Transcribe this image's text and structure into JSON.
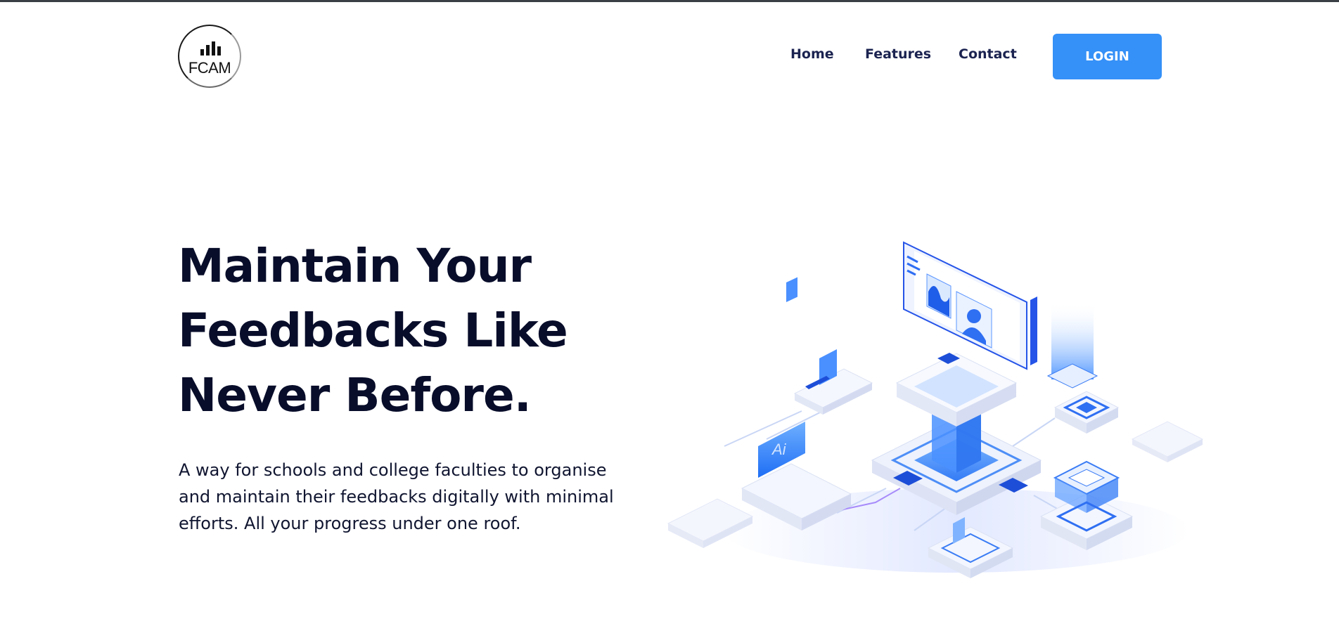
{
  "header": {
    "logo_text": "FCAM",
    "nav": [
      {
        "label": "Home"
      },
      {
        "label": "Features"
      },
      {
        "label": "Contact"
      }
    ],
    "login_label": "LOGIN"
  },
  "hero": {
    "headline_lines": [
      "Maintain Your",
      "Feedbacks Like",
      "Never Before."
    ],
    "subtext": "A way for schools and college faculties to organise and maintain their feedbacks digitally with minimal efforts. All your progress under one roof.",
    "illustration_badge": "Ai"
  },
  "colors": {
    "accent": "#3590f7",
    "heading": "#080d2a",
    "nav_text": "#1b2350"
  }
}
